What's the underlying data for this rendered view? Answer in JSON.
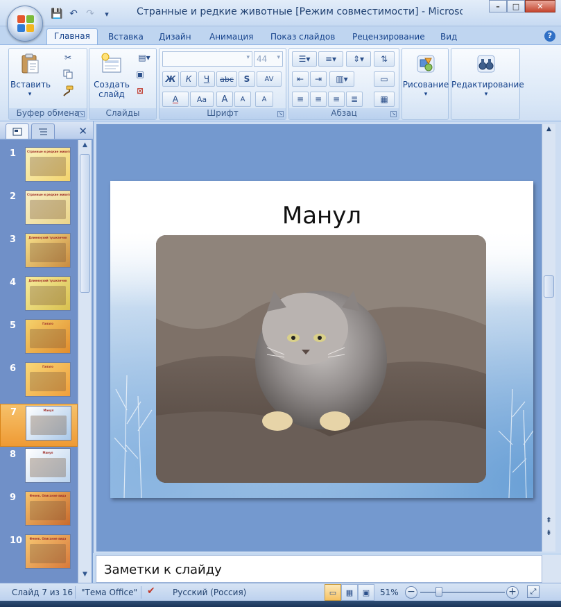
{
  "window": {
    "title": "Странные и редкие животные [Режим совместимости] - Microsof...",
    "minimize": "–",
    "maximize": "□",
    "close": "✕"
  },
  "qat": {
    "save": "💾",
    "undo": "↶",
    "redo": "↷",
    "more": "▾"
  },
  "tabs": [
    "Главная",
    "Вставка",
    "Дизайн",
    "Анимация",
    "Показ слайдов",
    "Рецензирование",
    "Вид"
  ],
  "help": "?",
  "ribbon": {
    "clipboard": {
      "paste_label": "Вставить",
      "paste_arrow": "▾",
      "group": "Буфер обмена"
    },
    "slides": {
      "new_slide_label": "Создать слайд",
      "new_slide_arrow": "▾",
      "group": "Слайды"
    },
    "font": {
      "font_name": "",
      "font_size": "44",
      "bold": "Ж",
      "italic": "К",
      "underline": "Ч",
      "strike": "abc",
      "shadow": "S",
      "spacing": "AV",
      "color": "A",
      "case": "Aa",
      "grow": "A",
      "shrink": "A",
      "clear": "A",
      "group": "Шрифт"
    },
    "paragraph": {
      "group": "Абзац"
    },
    "drawing": {
      "label": "Рисование",
      "arrow": "▾"
    },
    "editing": {
      "label": "Редактирование",
      "arrow": "▾"
    }
  },
  "left_panel": {
    "close": "✕",
    "thumbnails": [
      {
        "num": "1",
        "title": "Странные и редкие животные",
        "colors": [
          "#f8f2c0",
          "#f3d36c"
        ]
      },
      {
        "num": "2",
        "title": "Странные и редкие животные",
        "colors": [
          "#f8f0c8",
          "#ead48a"
        ]
      },
      {
        "num": "3",
        "title": "Длинноухий тушканчик",
        "colors": [
          "#f7e28d",
          "#c98a3e"
        ]
      },
      {
        "num": "4",
        "title": "Длинноухий тушканчик",
        "colors": [
          "#f7ec9c",
          "#d8c04e"
        ]
      },
      {
        "num": "5",
        "title": "Галаго",
        "colors": [
          "#f5d26c",
          "#e28c2c"
        ]
      },
      {
        "num": "6",
        "title": "Галаго",
        "colors": [
          "#f8d878",
          "#ef9e3a"
        ]
      },
      {
        "num": "7",
        "title": "Манул",
        "colors": [
          "#ffffff",
          "#a9c8e9"
        ]
      },
      {
        "num": "8",
        "title": "Манул",
        "colors": [
          "#ffffff",
          "#bcd4ee"
        ]
      },
      {
        "num": "9",
        "title": "Фенек. Описание вида",
        "colors": [
          "#f6c46e",
          "#c96a2c"
        ]
      },
      {
        "num": "10",
        "title": "Фенек. Описание вида",
        "colors": [
          "#f7c873",
          "#d8793a"
        ]
      }
    ]
  },
  "slide": {
    "title": "Манул"
  },
  "notes": {
    "placeholder": "Заметки к слайду"
  },
  "statusbar": {
    "slide_info": "Слайд 7 из 16",
    "theme": "\"Тема Office\"",
    "language": "Русский (Россия)",
    "zoom": "51%",
    "zoom_out": "−",
    "zoom_in": "+"
  }
}
